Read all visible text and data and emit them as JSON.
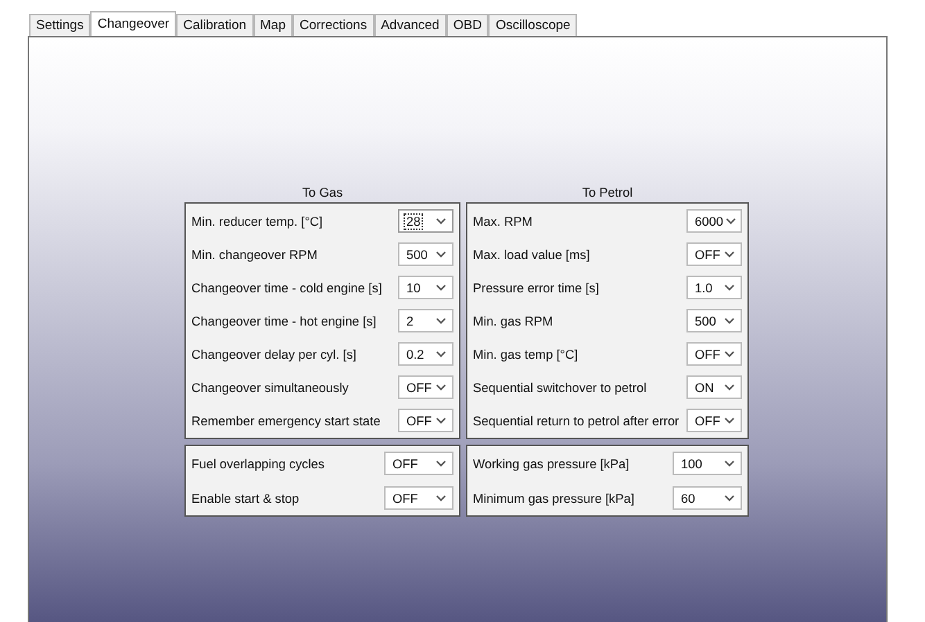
{
  "tabs": [
    {
      "label": "Settings",
      "selected": false
    },
    {
      "label": "Changeover",
      "selected": true
    },
    {
      "label": "Calibration",
      "selected": false
    },
    {
      "label": "Map",
      "selected": false
    },
    {
      "label": "Corrections",
      "selected": false
    },
    {
      "label": "Advanced",
      "selected": false
    },
    {
      "label": "OBD",
      "selected": false
    },
    {
      "label": "Oscilloscope",
      "selected": false
    }
  ],
  "to_gas": {
    "title": "To Gas",
    "rows": [
      {
        "label": "Min. reducer temp.  [°C]",
        "value": "28",
        "focused": true
      },
      {
        "label": "Min. changeover RPM",
        "value": "500",
        "focused": false
      },
      {
        "label": "Changeover time - cold engine [s]",
        "value": "10",
        "focused": false
      },
      {
        "label": "Changeover time - hot engine [s]",
        "value": "2",
        "focused": false
      },
      {
        "label": "Changeover delay per cyl. [s]",
        "value": "0.2",
        "focused": false
      },
      {
        "label": "Changeover simultaneously",
        "value": "OFF",
        "focused": false
      },
      {
        "label": "Remember emergency start state",
        "value": "OFF",
        "focused": false
      }
    ]
  },
  "to_petrol": {
    "title": "To Petrol",
    "rows": [
      {
        "label": "Max. RPM",
        "value": "6000",
        "focused": false
      },
      {
        "label": "Max. load value [ms]",
        "value": "OFF",
        "focused": false
      },
      {
        "label": "Pressure error time [s]",
        "value": "1.0",
        "focused": false
      },
      {
        "label": "Min. gas RPM",
        "value": "500",
        "focused": false
      },
      {
        "label": "Min. gas temp  [°C]",
        "value": "OFF",
        "focused": false
      },
      {
        "label": "Sequential switchover to petrol",
        "value": "ON",
        "focused": false
      },
      {
        "label": "Sequential return to petrol after error",
        "value": "OFF",
        "focused": false
      }
    ]
  },
  "fuel_panel": {
    "rows": [
      {
        "label": "Fuel overlapping cycles",
        "value": "OFF",
        "focused": false
      },
      {
        "label": "Enable start & stop",
        "value": "OFF",
        "focused": false
      }
    ]
  },
  "pressure_panel": {
    "rows": [
      {
        "label": "Working gas pressure  [kPa]",
        "value": "100",
        "focused": false
      },
      {
        "label": "Minimum gas pressure  [kPa]",
        "value": "60",
        "focused": false
      }
    ]
  }
}
